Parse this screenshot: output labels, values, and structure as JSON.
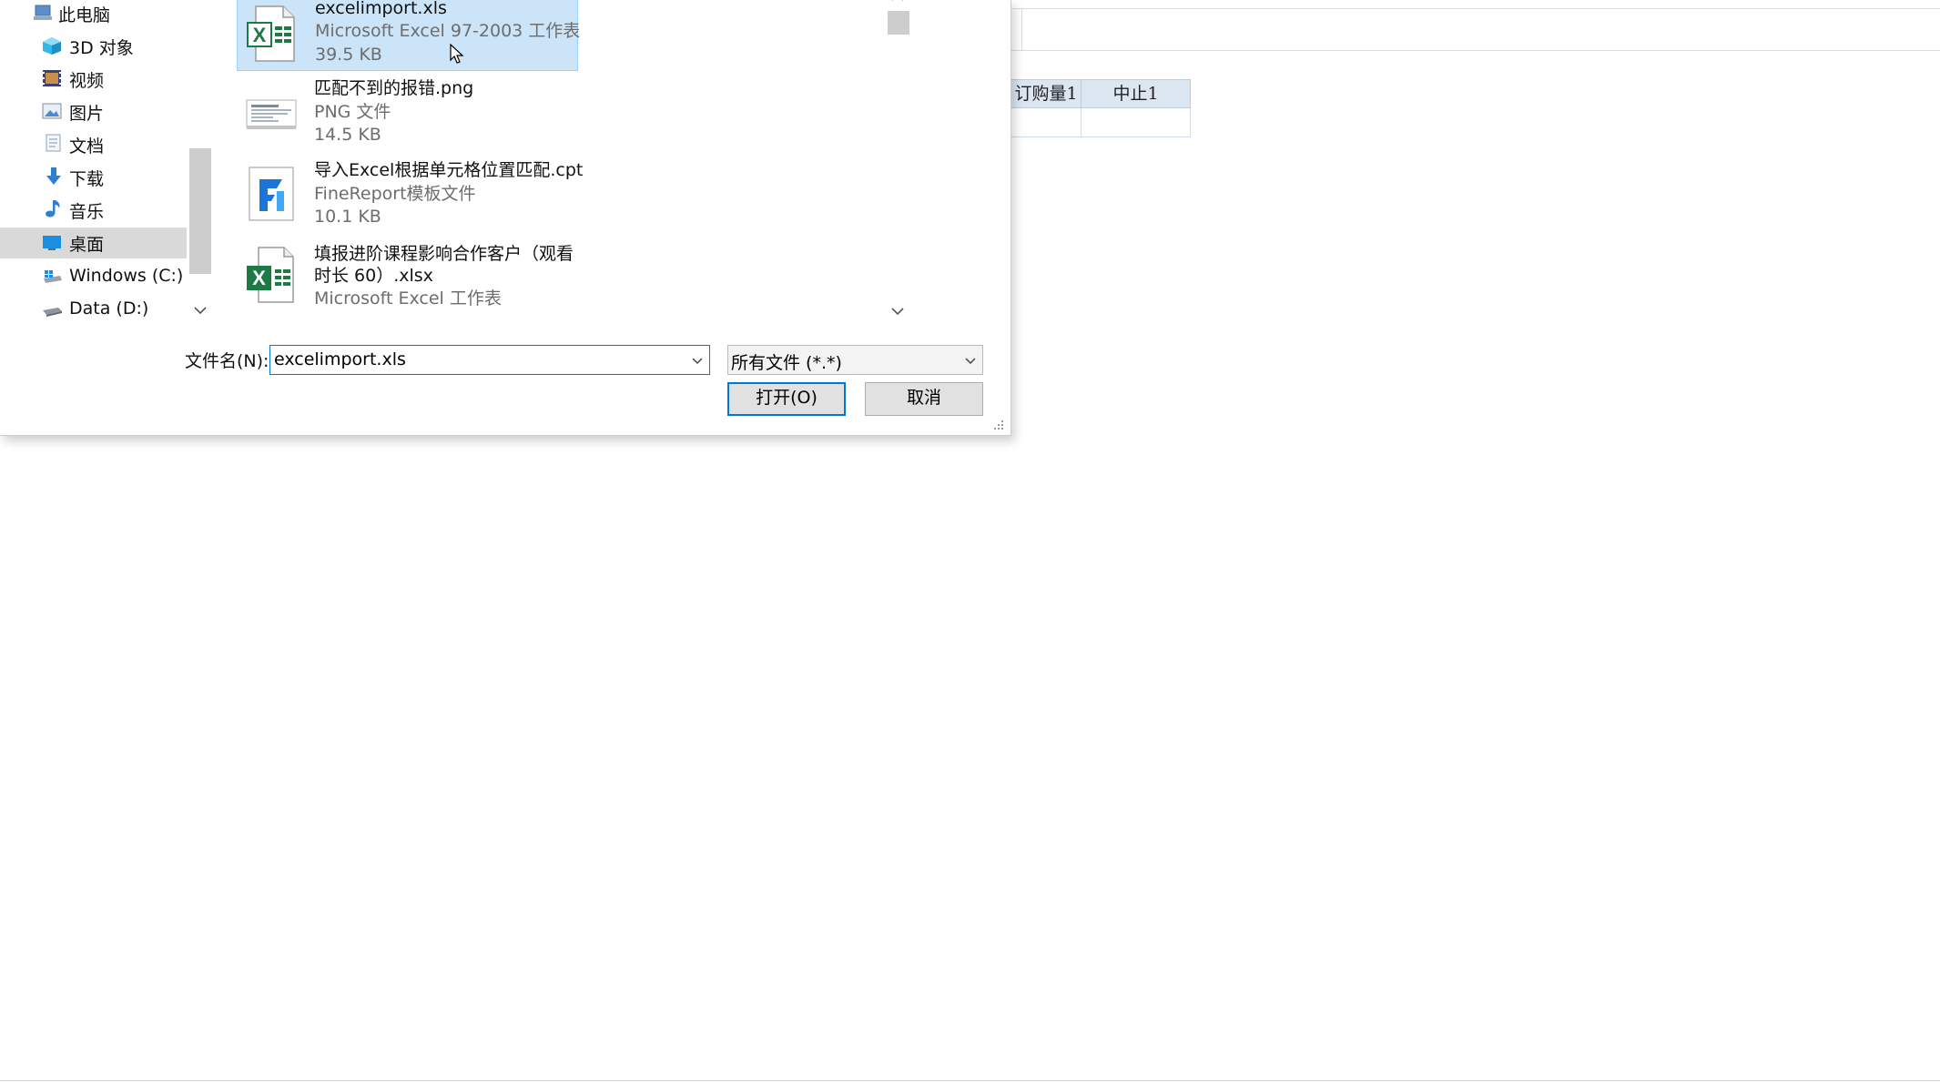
{
  "nav": {
    "items": [
      {
        "label": "此电脑",
        "icon": "computer-icon"
      },
      {
        "label": "3D 对象",
        "icon": "cube-3d-icon"
      },
      {
        "label": "视频",
        "icon": "video-icon"
      },
      {
        "label": "图片",
        "icon": "picture-icon"
      },
      {
        "label": "文档",
        "icon": "document-icon"
      },
      {
        "label": "下载",
        "icon": "download-arrow-icon"
      },
      {
        "label": "音乐",
        "icon": "music-note-icon"
      },
      {
        "label": "桌面",
        "icon": "desktop-icon",
        "selected": true
      },
      {
        "label": "Windows (C:)",
        "icon": "windows-drive-icon"
      },
      {
        "label": "Data (D:)",
        "icon": "drive-icon"
      }
    ]
  },
  "files": [
    {
      "name": "excelimport.xls",
      "type": "Microsoft Excel 97-2003 工作表",
      "size": "39.5 KB",
      "icon": "excel-xls-icon",
      "selected": true
    },
    {
      "name": "匹配不到的报错.png",
      "type": "PNG 文件",
      "size": "14.5 KB",
      "icon": "png-thumbnail-icon"
    },
    {
      "name": "导入Excel根据单元格位置匹配.cpt",
      "type": "FineReport模板文件",
      "size": "10.1 KB",
      "icon": "finereport-icon"
    },
    {
      "name_line1": "填报进阶课程影响合作客户（观看",
      "name_line2": "时长 60）.xlsx",
      "type": "Microsoft Excel 工作表",
      "icon": "excel-xlsx-icon"
    }
  ],
  "filename": {
    "label": "文件名(N):",
    "value": "excelimport.xls"
  },
  "filetype": {
    "value": "所有文件 (*.*)"
  },
  "buttons": {
    "open": "打开(O)",
    "cancel": "取消"
  },
  "background_grid": {
    "headers": [
      "订购量1",
      "中止1"
    ]
  },
  "colors": {
    "accent": "#0078d7",
    "selection": "#cce4f7",
    "selection_border": "#99d1ff",
    "grid_header": "#dbe6f1"
  }
}
